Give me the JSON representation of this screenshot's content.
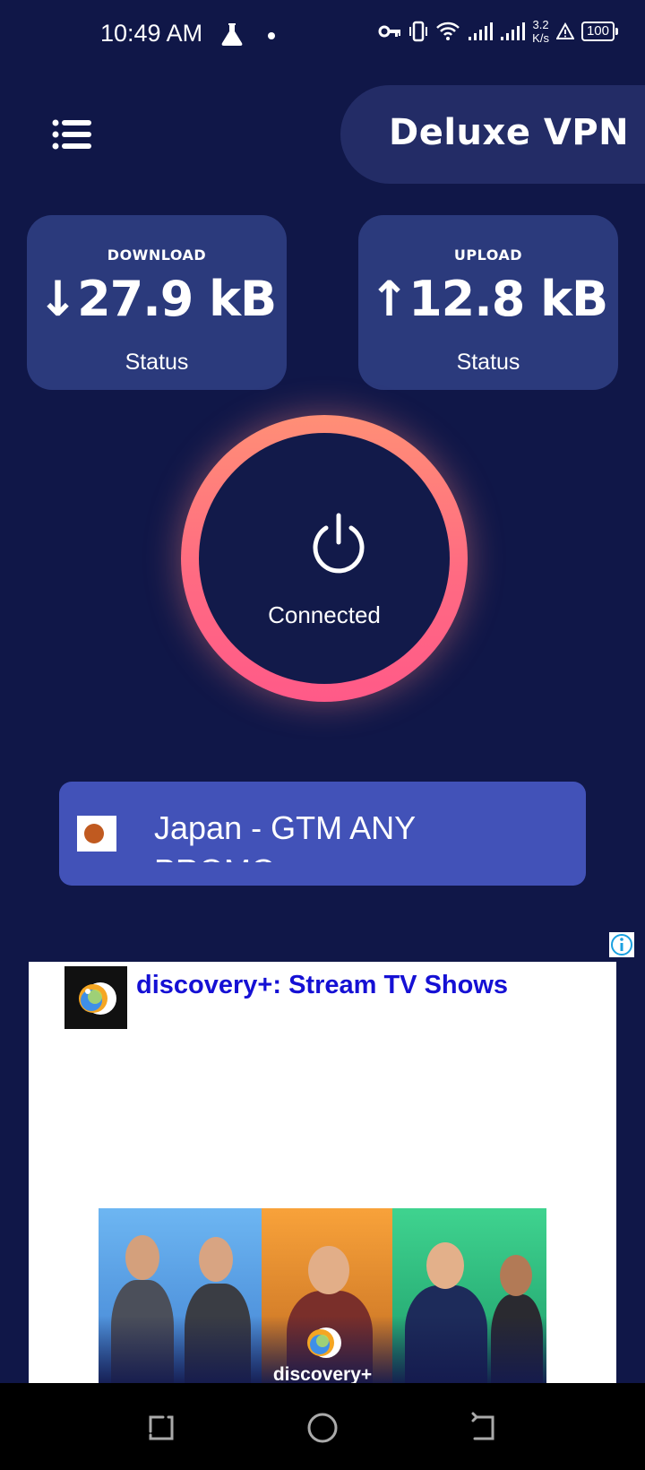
{
  "status_bar": {
    "time": "10:49 AM",
    "net_speed_value": "3.2",
    "net_speed_unit": "K/s",
    "battery": "100",
    "icons": [
      "flask-icon",
      "dot-icon",
      "vpn-key-icon",
      "vibrate-icon",
      "wifi-icon",
      "signal-icon",
      "signal-icon",
      "alert-icon",
      "battery-icon"
    ]
  },
  "header": {
    "menu_icon": "list-menu-icon",
    "title": "Deluxe VPN"
  },
  "stats": {
    "download": {
      "label": "DOWNLOAD",
      "arrow": "↓",
      "value": "27.9 kB",
      "sub": "Status"
    },
    "upload": {
      "label": "UPLOAD",
      "arrow": "↑",
      "value": "12.8 kB",
      "sub": "Status"
    }
  },
  "connection": {
    "icon": "power-icon",
    "status": "Connected",
    "ring_colors": [
      "#ff8f76",
      "#ff5a88"
    ]
  },
  "server": {
    "flag_icon": "japan-flag-icon",
    "name": "Japan - GTM ANY PROMO"
  },
  "ad": {
    "info_icon": "ad-info-icon",
    "title": "discovery+: Stream TV Shows",
    "logo_icon": "discovery-plus-logo-icon",
    "banner_brand": "discovery+",
    "title_color": "#1510d4"
  },
  "nav": {
    "recents_icon": "recents-icon",
    "home_icon": "home-icon",
    "back_icon": "back-icon"
  },
  "colors": {
    "background": "#101748",
    "card": "#2b3a7c",
    "server_button": "#4252b8"
  }
}
